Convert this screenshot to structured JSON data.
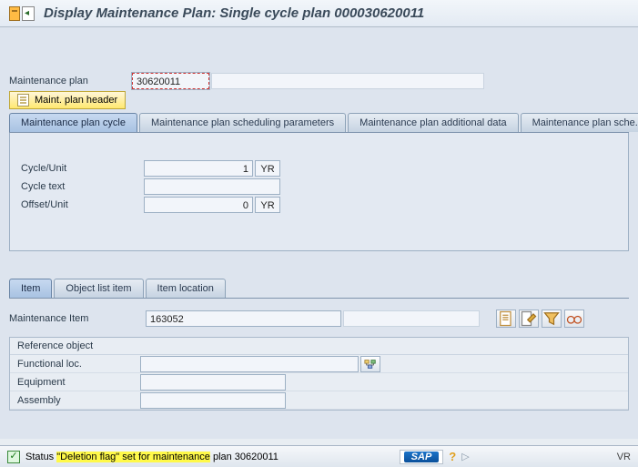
{
  "title": "Display Maintenance Plan: Single cycle plan 000030620011",
  "header": {
    "plan_label": "Maintenance plan",
    "plan_value": "30620011",
    "header_btn": "Maint. plan header"
  },
  "tabs": {
    "items": [
      "Maintenance plan cycle",
      "Maintenance plan scheduling parameters",
      "Maintenance plan additional data",
      "Maintenance plan sche..."
    ]
  },
  "cycle": {
    "cycle_label": "Cycle/Unit",
    "cycle_value": "1",
    "cycle_unit": "YR",
    "text_label": "Cycle text",
    "text_value": "",
    "offset_label": "Offset/Unit",
    "offset_value": "0",
    "offset_unit": "YR"
  },
  "subtabs": {
    "items": [
      "Item",
      "Object list item",
      "Item location"
    ]
  },
  "item": {
    "label": "Maintenance Item",
    "value": "163052"
  },
  "refobj": {
    "title": "Reference object",
    "func_label": "Functional loc.",
    "equip_label": "Equipment",
    "assy_label": "Assembly"
  },
  "status": {
    "prefix": "Status ",
    "highlight": "\"Deletion flag\" set for maintenance",
    "suffix": " plan 30620011",
    "sap": "SAP",
    "right": "VR"
  }
}
